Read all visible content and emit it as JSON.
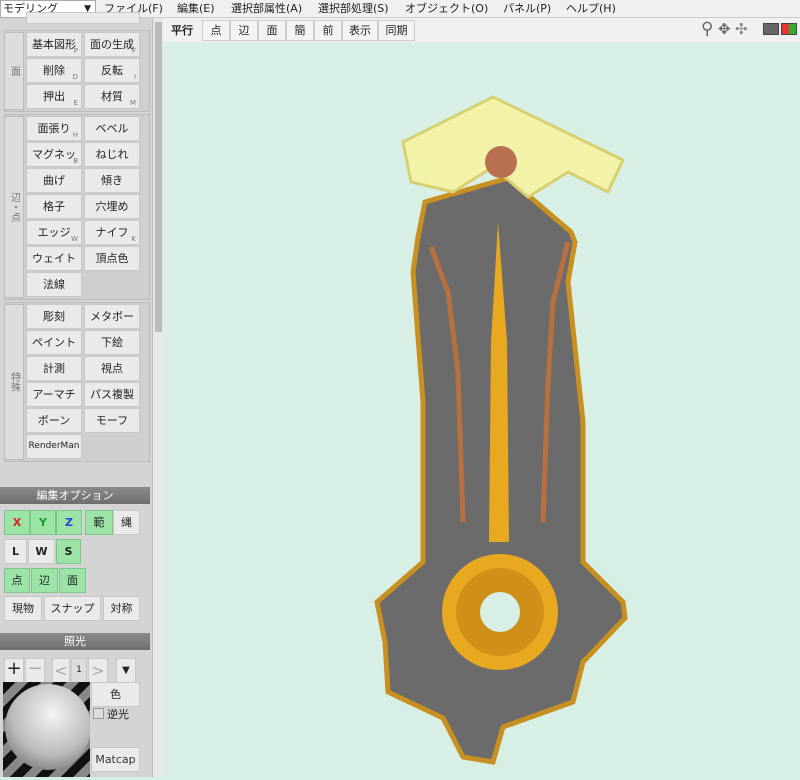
{
  "mode_select": "モデリング",
  "menu": [
    "ファイル(F)",
    "編集(E)",
    "選択部属性(A)",
    "選択部処理(S)",
    "オブジェクト(O)",
    "パネル(P)",
    "ヘルプ(H)"
  ],
  "toolbar": {
    "projection": "平行",
    "buttons": [
      "点",
      "辺",
      "面",
      "簡",
      "前",
      "表示",
      "同期"
    ],
    "active": "面"
  },
  "tools": {
    "group1": {
      "label": "面",
      "items": [
        [
          "基本図形",
          "P"
        ],
        [
          "面の生成",
          "F"
        ],
        [
          "削除",
          "D"
        ],
        [
          "反転",
          "I"
        ],
        [
          "押出",
          "E"
        ],
        [
          "材質",
          "M"
        ]
      ]
    },
    "group2": {
      "label": "辺・点",
      "items": [
        [
          "面張り",
          "H"
        ],
        [
          "ベベル",
          ""
        ],
        [
          "マグネット",
          "B"
        ],
        [
          "ねじれ",
          ""
        ],
        [
          "曲げ",
          ""
        ],
        [
          "傾き",
          ""
        ],
        [
          "格子",
          ""
        ],
        [
          "穴埋め",
          ""
        ],
        [
          "エッジ",
          "W"
        ],
        [
          "ナイフ",
          "K"
        ],
        [
          "ウェイト",
          ""
        ],
        [
          "頂点色",
          ""
        ],
        [
          "法線",
          ""
        ]
      ]
    },
    "group3": {
      "label": "特殊",
      "items": [
        [
          "彫刻",
          ""
        ],
        [
          "メタボール",
          ""
        ],
        [
          "ペイント",
          ""
        ],
        [
          "下絵",
          ""
        ],
        [
          "計測",
          ""
        ],
        [
          "視点",
          ""
        ],
        [
          "アーマチャー",
          ""
        ],
        [
          "パス複製",
          ""
        ],
        [
          "ボーン",
          ""
        ],
        [
          "モーフ",
          ""
        ],
        [
          "RenderMan",
          ""
        ]
      ]
    }
  },
  "edit_options": {
    "title": "編集オプション",
    "axes": [
      "X",
      "Y",
      "Z"
    ],
    "axis_colors": [
      "#e02020",
      "#10a020",
      "#3040d0"
    ],
    "range": "範",
    "rope": "縄",
    "coord": [
      "L",
      "W",
      "S"
    ],
    "active_coord": "S",
    "select": [
      "点",
      "辺",
      "面"
    ],
    "misc": [
      "現物",
      "スナップ",
      "対称"
    ]
  },
  "lighting": {
    "title": "照光",
    "plus": "+",
    "minus": "−",
    "prev": "<",
    "index": "1",
    "next": ">",
    "color": "色",
    "backlight": "逆光",
    "backlight_checked": false,
    "matcap": "Matcap"
  },
  "viewport_icons": [
    "search-icon",
    "move-icon",
    "rotate-icon",
    "single-view-icon",
    "multi-view-icon"
  ],
  "colors": {
    "viewport_bg": "#d8efe6",
    "active_green": "#9be3a6"
  }
}
